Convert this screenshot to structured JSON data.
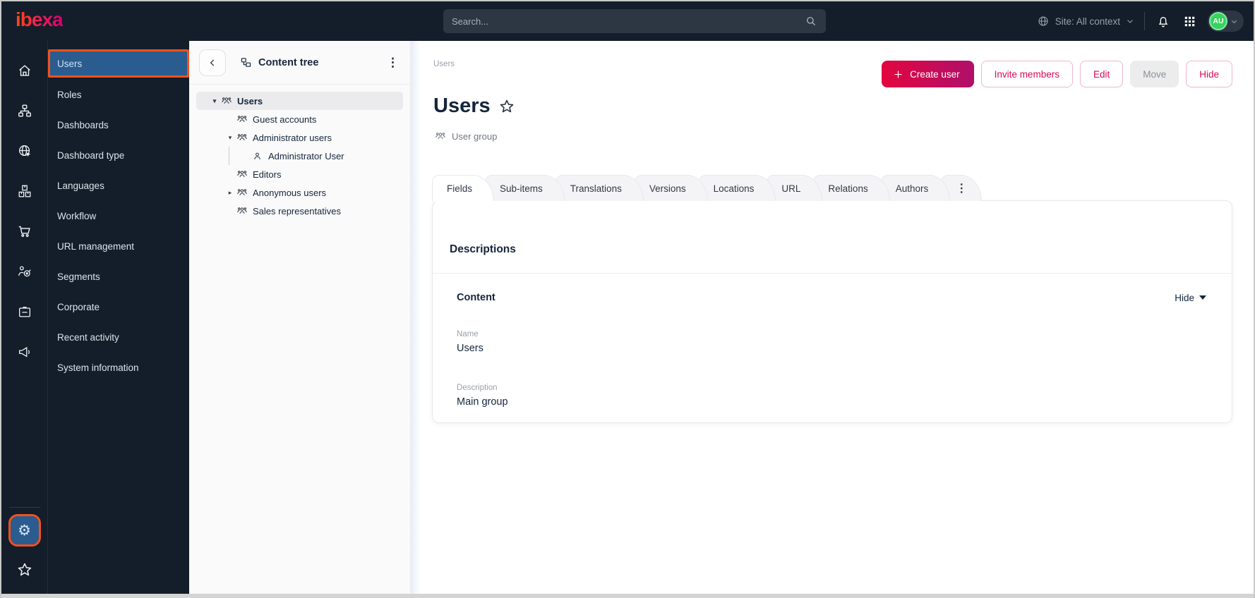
{
  "colors": {
    "topbar_bg": "#131e2a",
    "accent_orange": "#f4511e",
    "selected_blue": "#2b5c8f",
    "primary_gradient_start": "#e2063f",
    "primary_gradient_end": "#b00f6b",
    "action_pink": "#d6095a",
    "avatar_green": "#36d35e"
  },
  "topbar": {
    "logo_text": "ibexa",
    "search_placeholder": "Search...",
    "site_selector_label": "Site: All context",
    "avatar_initials": "AU"
  },
  "sidebar": {
    "items": [
      {
        "label": "Users",
        "selected": true
      },
      {
        "label": "Roles"
      },
      {
        "label": "Dashboards"
      },
      {
        "label": "Dashboard type"
      },
      {
        "label": "Languages"
      },
      {
        "label": "Workflow"
      },
      {
        "label": "URL management"
      },
      {
        "label": "Segments"
      },
      {
        "label": "Corporate"
      },
      {
        "label": "Recent activity"
      },
      {
        "label": "System information"
      }
    ]
  },
  "content_tree": {
    "title": "Content tree",
    "nodes": [
      {
        "label": "Users",
        "depth": 0,
        "state": "expanded",
        "icon": "user-group",
        "selected": true
      },
      {
        "label": "Guest accounts",
        "depth": 1,
        "state": "leaf",
        "icon": "user-group"
      },
      {
        "label": "Administrator users",
        "depth": 1,
        "state": "expanded",
        "icon": "user-group"
      },
      {
        "label": "Administrator User",
        "depth": 2,
        "state": "leaf",
        "icon": "user"
      },
      {
        "label": "Editors",
        "depth": 1,
        "state": "leaf",
        "icon": "user-group"
      },
      {
        "label": "Anonymous users",
        "depth": 1,
        "state": "collapsed",
        "icon": "user-group"
      },
      {
        "label": "Sales representatives",
        "depth": 1,
        "state": "leaf",
        "icon": "user-group"
      }
    ]
  },
  "main": {
    "breadcrumb": "Users",
    "actions": {
      "create_user": "Create user",
      "invite_members": "Invite members",
      "edit": "Edit",
      "move": "Move",
      "hide": "Hide"
    },
    "title": "Users",
    "content_type": "User group",
    "tabs": [
      {
        "label": "Fields",
        "active": true
      },
      {
        "label": "Sub-items"
      },
      {
        "label": "Translations"
      },
      {
        "label": "Versions"
      },
      {
        "label": "Locations"
      },
      {
        "label": "URL"
      },
      {
        "label": "Relations"
      },
      {
        "label": "Authors"
      }
    ],
    "card": {
      "section_title": "Descriptions",
      "group_heading": "Content",
      "collapse_label": "Hide",
      "fields": [
        {
          "label": "Name",
          "value": "Users"
        },
        {
          "label": "Description",
          "value": "Main group"
        }
      ]
    }
  }
}
